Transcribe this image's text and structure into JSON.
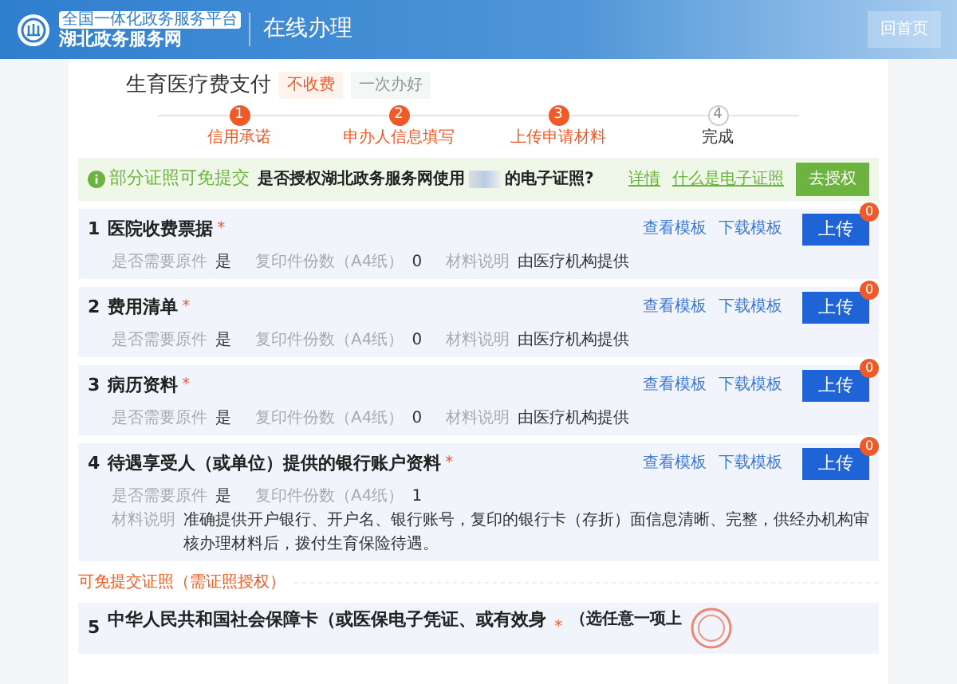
{
  "header": {
    "platform_tag": "全国一体化政务服务平台",
    "site_name": "湖北政务服务网",
    "section": "在线办理",
    "home_button": "回首页"
  },
  "service": {
    "title": "生育医疗费支付",
    "tags": [
      {
        "label": "不收费",
        "kind": "fee"
      },
      {
        "label": "一次办好",
        "kind": "once"
      }
    ]
  },
  "steps": [
    {
      "number": "1",
      "label": "信用承诺",
      "done": true
    },
    {
      "number": "2",
      "label": "申办人信息填写",
      "done": true
    },
    {
      "number": "3",
      "label": "上传申请材料",
      "done": true
    },
    {
      "number": "4",
      "label": "完成",
      "done": false
    }
  ],
  "auth_bar": {
    "headline": "部分证照可免提交",
    "question_start": "是否授权湖北政务服务网使用",
    "question_end": "的电子证照?",
    "links": [
      "详情",
      "什么是电子证照"
    ],
    "button": "去授权"
  },
  "materials": [
    {
      "number": "1",
      "title": "医院收费票据",
      "required_mark": "*",
      "links": [
        "查看模板",
        "下载模板"
      ],
      "button": "上传",
      "count": "0",
      "fields": [
        {
          "label": "是否需要原件",
          "value": "是"
        },
        {
          "label": "复印件份数（A4纸）",
          "value": "0"
        },
        {
          "label": "材料说明",
          "value": "由医疗机构提供"
        }
      ]
    },
    {
      "number": "2",
      "title": "费用清单",
      "required_mark": "*",
      "links": [
        "查看模板",
        "下载模板"
      ],
      "button": "上传",
      "count": "0",
      "fields": [
        {
          "label": "是否需要原件",
          "value": "是"
        },
        {
          "label": "复印件份数（A4纸）",
          "value": "0"
        },
        {
          "label": "材料说明",
          "value": "由医疗机构提供"
        }
      ]
    },
    {
      "number": "3",
      "title": "病历资料",
      "required_mark": "*",
      "links": [
        "查看模板",
        "下载模板"
      ],
      "button": "上传",
      "count": "0",
      "fields": [
        {
          "label": "是否需要原件",
          "value": "是"
        },
        {
          "label": "复印件份数（A4纸）",
          "value": "0"
        },
        {
          "label": "材料说明",
          "value": "由医疗机构提供"
        }
      ]
    },
    {
      "number": "4",
      "title": "待遇享受人（或单位）提供的银行账户资料",
      "required_mark": "*",
      "links": [
        "查看模板",
        "下载模板"
      ],
      "button": "上传",
      "count": "0",
      "fields": [
        {
          "label": "是否需要原件",
          "value": "是"
        },
        {
          "label": "复印件份数（A4纸）",
          "value": "1"
        },
        {
          "label": "材料说明",
          "value": "准确提供开户银行、开户名、银行账号，复印的银行卡（存折）面信息清晰、完整，供经办机构审核办理材料后，拨付生育保险待遇。"
        }
      ]
    }
  ],
  "exempt_section": {
    "heading": "可免提交证照（需证照授权）",
    "items": [
      {
        "number": "5",
        "title": "中华人民共和国社会保障卡（或医保电子凭证、或有效身",
        "required_mark": "*",
        "note": "（选任意一项上"
      }
    ]
  }
}
